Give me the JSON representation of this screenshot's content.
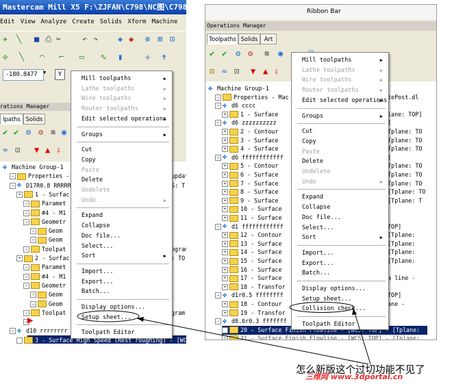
{
  "left_window": {
    "title": "Mastercam Mill X5  F:\\ZJFAN\\C798\\NC图\\C798",
    "menu": [
      "Edit",
      "View",
      "Analyze",
      "Create",
      "Solids",
      "Xform",
      "Machine"
    ],
    "coord_value": "-180.8477",
    "coord_axis": "Y",
    "ops_manager_label": "rations Manager",
    "tabs": [
      "lpaths",
      "Solids"
    ],
    "tree": [
      "Machine Group-1",
      "Properties - ",
      "D17R0.8 RRRRR",
      "1 - Surfac",
      "Paramet",
      "#4 - M1",
      "Geometr",
      "Geom",
      "Geom",
      "Toolpat",
      "2 - Surfac",
      "Paramet",
      "#4 - M1",
      "Geometr",
      "Geom",
      "Geom",
      "Toolpat",
      "",
      "d10 rrrrrrrr",
      "3 - Surface High Speed (Rest roughing) - [WCS"
    ],
    "tree_right_fragments": [
      {
        "text": "updat",
        "row": 1
      },
      {
        "text": "S: T",
        "row": 2
      },
      {
        "text": "ogram",
        "row": 9
      },
      {
        "text": ": TO",
        "row": 10
      },
      {
        "text": "gram",
        "row": 16
      }
    ],
    "context_menu": [
      {
        "label": "Mill toolpaths",
        "submenu": true,
        "disabled": false
      },
      {
        "label": "Lathe toolpaths",
        "submenu": true,
        "disabled": true
      },
      {
        "label": "Wire toolpaths",
        "submenu": true,
        "disabled": true
      },
      {
        "label": "Router toolpaths",
        "submenu": true,
        "disabled": true
      },
      {
        "label": "Edit selected operations",
        "submenu": true,
        "disabled": false
      },
      {
        "sep": true
      },
      {
        "label": "Groups",
        "submenu": true,
        "disabled": false
      },
      {
        "sep": true
      },
      {
        "label": "Cut",
        "disabled": false
      },
      {
        "label": "Copy",
        "disabled": false
      },
      {
        "label": "Paste",
        "disabled": true
      },
      {
        "label": "Delete",
        "disabled": false
      },
      {
        "label": "Undelete",
        "disabled": true
      },
      {
        "label": "Undo",
        "submenu": true,
        "disabled": true
      },
      {
        "sep": true
      },
      {
        "label": "Expand",
        "disabled": false
      },
      {
        "label": "Collapse",
        "disabled": false
      },
      {
        "label": "Doc file...",
        "disabled": false
      },
      {
        "label": "Select...",
        "disabled": false
      },
      {
        "label": "Sort",
        "submenu": true,
        "disabled": false
      },
      {
        "sep": true
      },
      {
        "label": "Import...",
        "disabled": false
      },
      {
        "label": "Export...",
        "disabled": false
      },
      {
        "label": "Batch...",
        "disabled": false
      },
      {
        "sep": true
      },
      {
        "label": "Display options...",
        "disabled": false
      },
      {
        "label": "Setup sheet...",
        "disabled": false
      },
      {
        "sep": true
      },
      {
        "label": "Toolpath Editor",
        "disabled": false
      }
    ]
  },
  "right_window": {
    "ribbon_label": "Ribbon Bar",
    "ops_manager_label": "Operations Manager",
    "tabs": [
      "Toolpaths",
      "Solids",
      "Art"
    ],
    "tree": [
      "Machine Group-1",
      "Properties - Mac",
      "d6 cccc",
      "1 - Surface",
      "d6 zzzzzzzzzz",
      "2 - Contour",
      "3 - Surface",
      "4 - Surface",
      "d6 ffffffffffff",
      "5 - Contour",
      "6 - Surface",
      "7 - Surface",
      "8 - Surface",
      "9 - Surface",
      "10 - Surface",
      "11 - Surface",
      "d1 ffffffffffff",
      "12 - Contour",
      "13 - Surface",
      "14 - Surface",
      "15 - Surface",
      "16 - Surface",
      "17 - Surface",
      "18 - Transfor",
      "d1r0.5 ffffffff",
      "18 - Contour",
      "19 - Transfor",
      "d0.6r0.3 fffffff",
      "20 - Surface Finish Flowline - [WCS: TOP] - [Tplane:",
      "21 - Surface Finish Flowline - [WCS: TOP] - [Tplane:"
    ],
    "tree_right_fragments": [
      {
        "text": "tePost.dl",
        "row": 1
      },
      {
        "text": "lane: TOP]",
        "row": 3
      },
      {
        "text": "]",
        "row": 4
      },
      {
        "text": "Tplane: TO",
        "row": 5
      },
      {
        "text": "Tplane: TO",
        "row": 6
      },
      {
        "text": "Tplane: TO",
        "row": 7
      },
      {
        "text": "]",
        "row": 8
      },
      {
        "text": "Tplane: TO",
        "row": 9
      },
      {
        "text": "Tplane: TO",
        "row": 10
      },
      {
        "text": "Tplane: TO",
        "row": 11
      },
      {
        "text": "[Tplane: TO",
        "row": 12
      },
      {
        "text": "[Tplane: T",
        "row": 13
      },
      {
        "text": "TOP]",
        "row": 16
      },
      {
        "text": "[Tplane:",
        "row": 17
      },
      {
        "text": "[Tplane:",
        "row": 18
      },
      {
        "text": "[Tplane:",
        "row": 19
      },
      {
        "text": "[Tplane:",
        "row": 20
      },
      {
        "text": "a line -",
        "row": 22
      },
      {
        "text": "TOP]",
        "row": 24
      },
      {
        "text": "ane - ",
        "row": 25
      }
    ],
    "context_menu": [
      {
        "label": "Mill toolpaths",
        "submenu": true,
        "disabled": false
      },
      {
        "label": "Lathe toolpaths",
        "submenu": true,
        "disabled": true
      },
      {
        "label": "Wire toolpaths",
        "submenu": true,
        "disabled": true
      },
      {
        "label": "Router toolpaths",
        "submenu": true,
        "disabled": true
      },
      {
        "label": "Edit selected operations",
        "submenu": true,
        "disabled": false
      },
      {
        "sep": true
      },
      {
        "label": "Groups",
        "submenu": true,
        "disabled": false
      },
      {
        "sep": true
      },
      {
        "label": "Cut",
        "disabled": false
      },
      {
        "label": "Copy",
        "disabled": false
      },
      {
        "label": "Paste",
        "disabled": true
      },
      {
        "label": "Delete",
        "disabled": false
      },
      {
        "label": "Undelete",
        "disabled": true
      },
      {
        "label": "Undo",
        "submenu": true,
        "disabled": true
      },
      {
        "sep": true
      },
      {
        "label": "Expand",
        "disabled": false
      },
      {
        "label": "Collapse",
        "disabled": false
      },
      {
        "label": "Doc file...",
        "disabled": false
      },
      {
        "label": "Select...",
        "disabled": false
      },
      {
        "label": "Sort",
        "submenu": true,
        "disabled": false
      },
      {
        "sep": true
      },
      {
        "label": "Import...",
        "disabled": false
      },
      {
        "label": "Export...",
        "disabled": false
      },
      {
        "label": "Batch...",
        "disabled": false
      },
      {
        "sep": true
      },
      {
        "label": "Display options...",
        "disabled": false
      },
      {
        "label": "Setup sheet...",
        "disabled": false
      },
      {
        "label": "Collision check...",
        "disabled": false
      },
      {
        "sep": true
      },
      {
        "label": "Toolpath Editor",
        "disabled": false
      }
    ]
  },
  "annotation": {
    "caption": "怎么新版这个过切功能不见了",
    "watermark": "三维网 www.3dportal.cn",
    "colors": {
      "highlight": "#0a246a",
      "accent_red": "#e00000",
      "watermark": "#e53030"
    }
  }
}
